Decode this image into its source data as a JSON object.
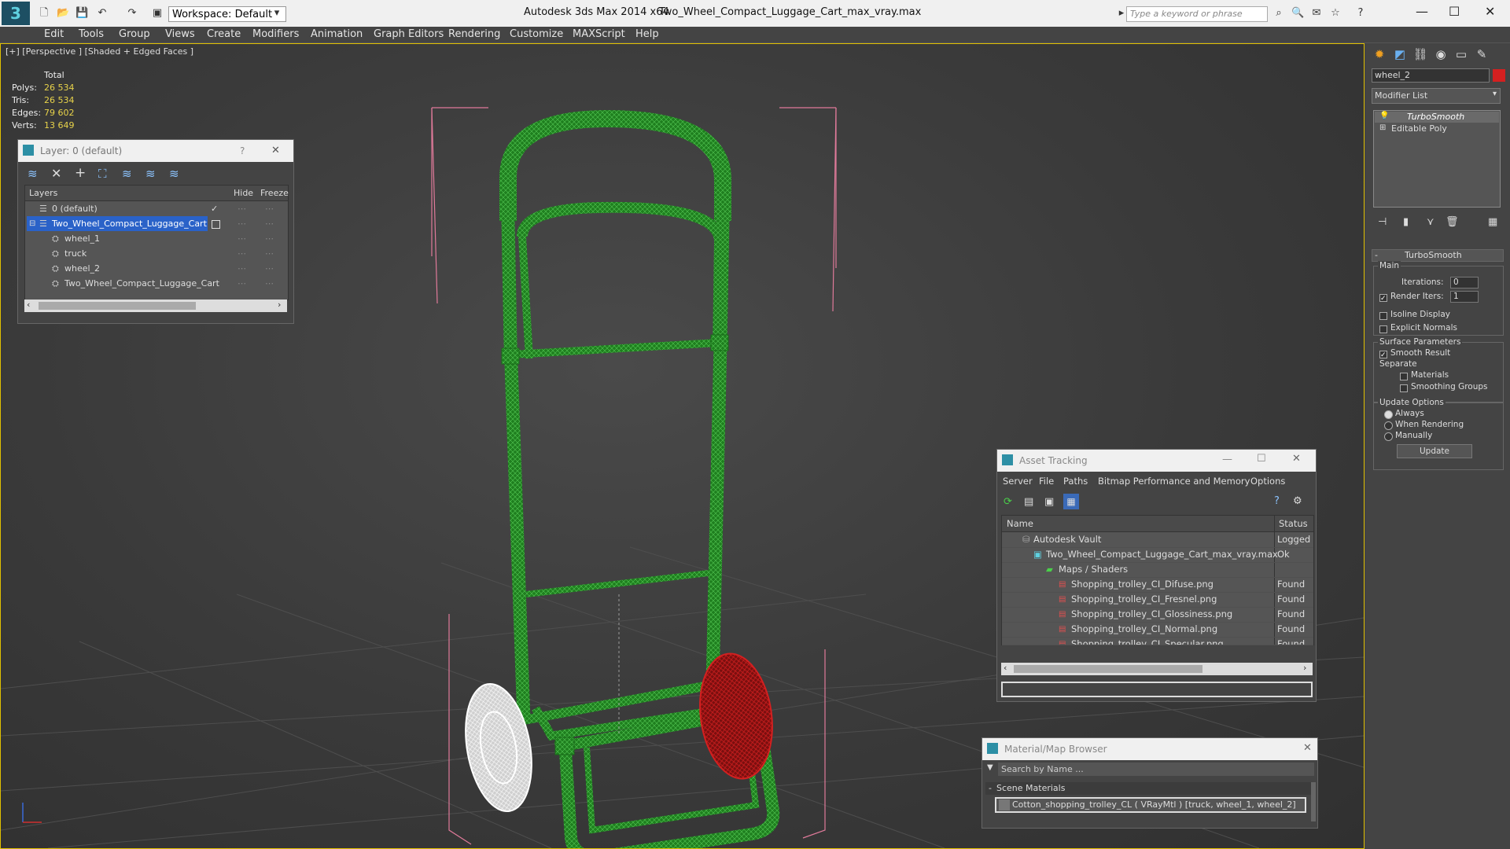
{
  "titlebar": {
    "workspace_label": "Workspace: Default",
    "app_title": "Autodesk 3ds Max  2014 x64",
    "file_title": "Two_Wheel_Compact_Luggage_Cart_max_vray.max",
    "search_placeholder": "Type a keyword or phrase"
  },
  "menu": [
    "Edit",
    "Tools",
    "Group",
    "Views",
    "Create",
    "Modifiers",
    "Animation",
    "Graph Editors",
    "Rendering",
    "Customize",
    "MAXScript",
    "Help"
  ],
  "viewport": {
    "label": "[+] [Perspective ] [Shaded + Edged Faces ]",
    "stats": {
      "total_label": "Total",
      "polys_label": "Polys:",
      "polys": "26 534",
      "tris_label": "Tris:",
      "tris": "26 534",
      "edges_label": "Edges:",
      "edges": "79 602",
      "verts_label": "Verts:",
      "verts": "13 649"
    },
    "colors": {
      "cart": "#1e8a1e",
      "wheel_left": "#e8e8e8",
      "wheel_right": "#b01a1a",
      "bbox": "#e07a9a",
      "border": "#e0c000"
    }
  },
  "layer_panel": {
    "title": "Layer: 0 (default)",
    "help": "?",
    "close": "✕",
    "col_layers": "Layers",
    "col_hide": "Hide",
    "col_freeze": "Freeze",
    "rows": [
      {
        "name": "0 (default)",
        "indent": 0
      },
      {
        "name": "Two_Wheel_Compact_Luggage_Cart",
        "indent": 0
      },
      {
        "name": "wheel_1",
        "indent": 1
      },
      {
        "name": "truck",
        "indent": 1
      },
      {
        "name": "wheel_2",
        "indent": 1
      },
      {
        "name": "Two_Wheel_Compact_Luggage_Cart",
        "indent": 1
      }
    ]
  },
  "command_panel": {
    "object_name": "wheel_2",
    "modifier_list": "Modifier List",
    "stack": [
      "TurboSmooth",
      "Editable Poly"
    ],
    "rollout_title": "TurboSmooth",
    "main_label": "Main",
    "iterations_label": "Iterations:",
    "iterations": "0",
    "render_iters_label": "Render Iters:",
    "render_iters": "1",
    "isoline": "Isoline Display",
    "explicit_normals": "Explicit Normals",
    "surface_params": "Surface Parameters",
    "smooth_result": "Smooth Result",
    "separate": "Separate",
    "materials": "Materials",
    "smoothing_groups": "Smoothing Groups",
    "update_options": "Update Options",
    "always": "Always",
    "when_rendering": "When Rendering",
    "manually": "Manually",
    "update_btn": "Update"
  },
  "asset_tracking": {
    "title": "Asset Tracking",
    "menu": [
      "Server",
      "File",
      "Paths",
      "Bitmap Performance and Memory",
      "Options"
    ],
    "col_name": "Name",
    "col_status": "Status",
    "rows": [
      {
        "name": "Autodesk Vault",
        "status": "Logged C",
        "indent": 1
      },
      {
        "name": "Two_Wheel_Compact_Luggage_Cart_max_vray.max",
        "status": "Ok",
        "indent": 2
      },
      {
        "name": "Maps / Shaders",
        "status": "",
        "indent": 3
      },
      {
        "name": "Shopping_trolley_CI_Difuse.png",
        "status": "Found",
        "indent": 4
      },
      {
        "name": "Shopping_trolley_CI_Fresnel.png",
        "status": "Found",
        "indent": 4
      },
      {
        "name": "Shopping_trolley_CI_Glossiness.png",
        "status": "Found",
        "indent": 4
      },
      {
        "name": "Shopping_trolley_CI_Normal.png",
        "status": "Found",
        "indent": 4
      },
      {
        "name": "Shopping_trolley_CI_Specular.png",
        "status": "Found",
        "indent": 4
      }
    ]
  },
  "material_browser": {
    "title": "Material/Map Browser",
    "search_placeholder": "Search by Name ...",
    "section": "Scene Materials",
    "item": "Cotton_shopping_trolley_CL  ( VRayMtl ) [truck, wheel_1, wheel_2]"
  }
}
